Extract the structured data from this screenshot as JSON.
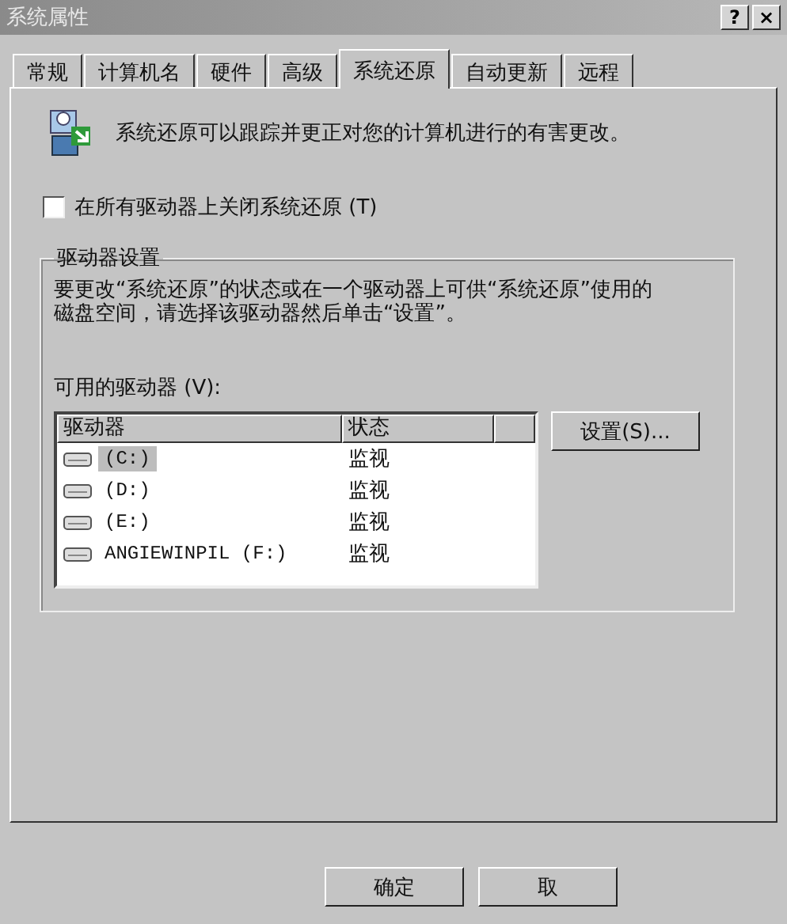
{
  "window": {
    "title": "系统属性",
    "help_button": "?",
    "close_button": "×"
  },
  "tabs": [
    {
      "label": "常规",
      "selected": false
    },
    {
      "label": "计算机名",
      "selected": false
    },
    {
      "label": "硬件",
      "selected": false
    },
    {
      "label": "高级",
      "selected": false
    },
    {
      "label": "系统还原",
      "selected": true
    },
    {
      "label": "自动更新",
      "selected": false
    },
    {
      "label": "远程",
      "selected": false
    }
  ],
  "intro": "系统还原可以跟踪并更正对您的计算机进行的有害更改。",
  "disable_checkbox": {
    "label": "在所有驱动器上关闭系统还原 (T)",
    "checked": false
  },
  "drive_settings": {
    "title": "驱动器设置",
    "description": "要更改“系统还原”的状态或在一个驱动器上可供“系统还原”使用的磁盘空间，请选择该驱动器然后单击“设置”。",
    "list_label": "可用的驱动器 (V):",
    "table": {
      "columns": [
        "驱动器",
        "状态"
      ],
      "rows": [
        {
          "drive": "(C:)",
          "status": "监视",
          "selected": true
        },
        {
          "drive": "(D:)",
          "status": "监视",
          "selected": false
        },
        {
          "drive": "(E:)",
          "status": "监视",
          "selected": false
        },
        {
          "drive": "ANGIEWINPIL (F:)",
          "status": "监视",
          "selected": false
        }
      ]
    },
    "settings_button": "设置(S)..."
  },
  "buttons": [
    "确定",
    "取"
  ]
}
